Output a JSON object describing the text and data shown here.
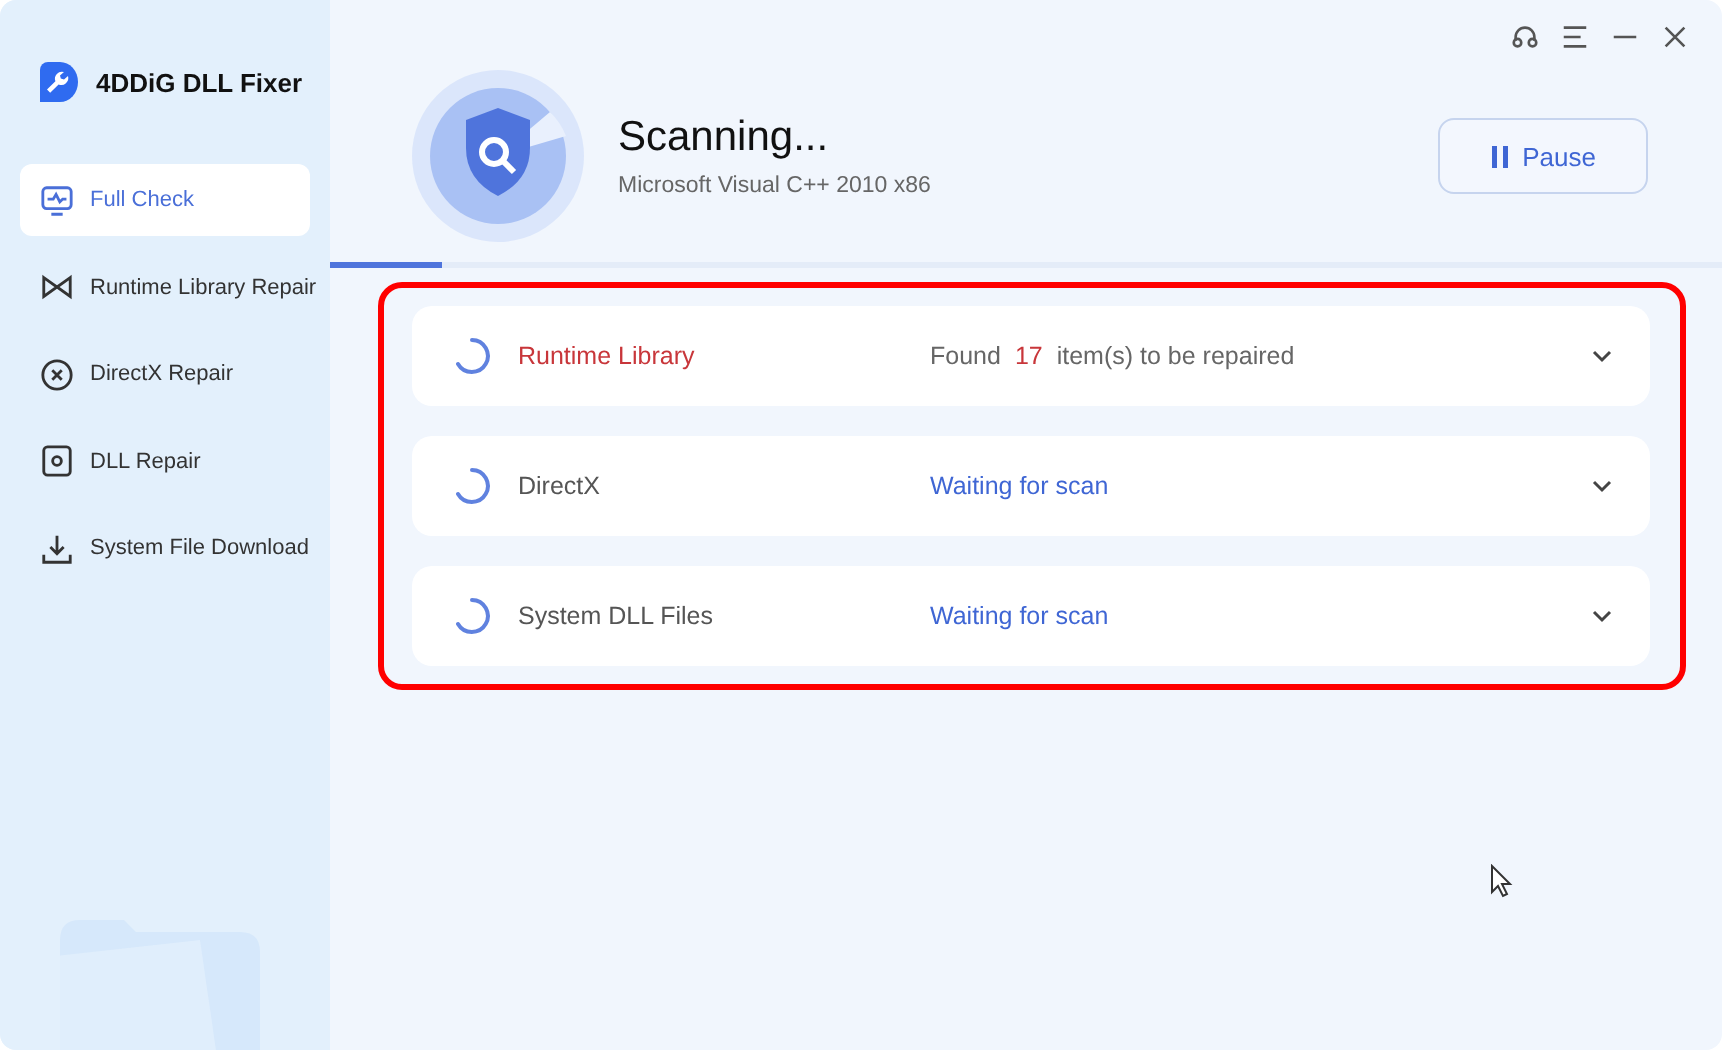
{
  "app": {
    "name": "4DDiG DLL Fixer"
  },
  "sidebar": {
    "items": [
      {
        "label": "Full Check",
        "selected": true
      },
      {
        "label": "Runtime Library Repair",
        "selected": false
      },
      {
        "label": "DirectX Repair",
        "selected": false
      },
      {
        "label": "DLL Repair",
        "selected": false
      },
      {
        "label": "System File Download",
        "selected": false
      }
    ]
  },
  "scan": {
    "title": "Scanning...",
    "subtitle": "Microsoft Visual C++ 2010 x86",
    "level": 0.08,
    "pause_button": "Pause"
  },
  "results": [
    {
      "name": "Runtime Library",
      "kind": "found",
      "status": "Found",
      "count": "17",
      "status_suffix": "item(s) to be repaired"
    },
    {
      "name": "DirectX",
      "kind": "waiting",
      "status": "Waiting for scan"
    },
    {
      "name": "System DLL Files",
      "kind": "waiting",
      "status": "Waiting for scan"
    }
  ]
}
